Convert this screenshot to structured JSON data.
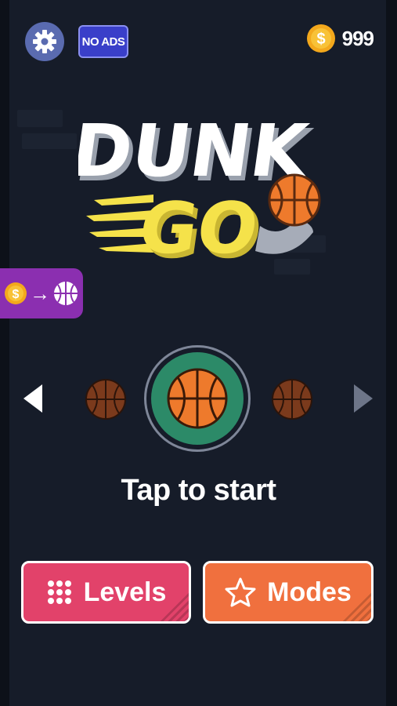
{
  "app": {
    "title_line1": "DUNK",
    "title_line2": "GO"
  },
  "header": {
    "no_ads_label": "NO ADS",
    "coin_symbol": "$",
    "coin_count": "999",
    "icons": {
      "settings": "gear-icon",
      "coin": "coin-icon"
    }
  },
  "shop_tab": {
    "coin_symbol": "$",
    "arrow": "→",
    "icons": {
      "coin": "coin-icon",
      "ball": "basketball-icon"
    }
  },
  "carousel": {
    "left_arrow": "left-arrow-icon",
    "right_arrow": "right-arrow-icon",
    "balls": [
      {
        "name": "ball-prev",
        "state": "locked"
      },
      {
        "name": "ball-selected",
        "state": "selected"
      },
      {
        "name": "ball-next",
        "state": "locked"
      }
    ]
  },
  "prompt": {
    "tap_to_start": "Tap to start"
  },
  "buttons": {
    "levels_label": "Levels",
    "modes_label": "Modes",
    "icons": {
      "levels": "grid-dots-icon",
      "modes": "star-icon"
    }
  },
  "colors": {
    "background": "#161c29",
    "no_ads": "#3a3fc9",
    "settings": "#5a6bb0",
    "shop_tab": "#8b2fb0",
    "ring_fill": "#2c8a68",
    "levels": "#e2426a",
    "modes": "#f0703e",
    "logo_yellow": "#f5e24a",
    "ball_orange": "#ee7a2c"
  }
}
